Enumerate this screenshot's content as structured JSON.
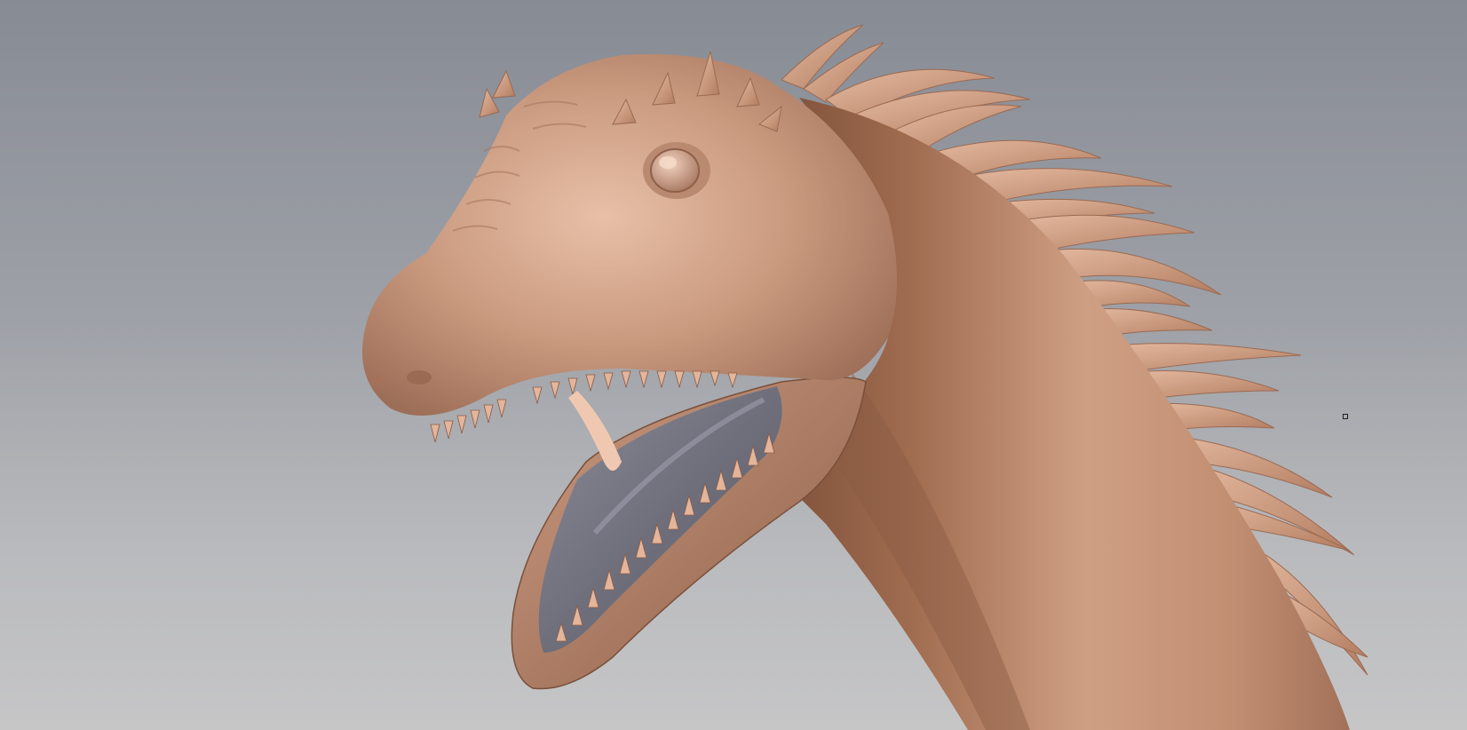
{
  "viewport": {
    "background_top": "#878b94",
    "background_bottom": "#c6c6c7",
    "model": {
      "subject": "dinosaur-head-sculpt",
      "material_color": "#c7957a",
      "material_shadow": "#7a4f3a",
      "material_highlight": "#edc6ad",
      "mouth_interior_color": "#6f6f7c"
    },
    "pivot_marker": {
      "icon": "square-handle-icon"
    }
  }
}
